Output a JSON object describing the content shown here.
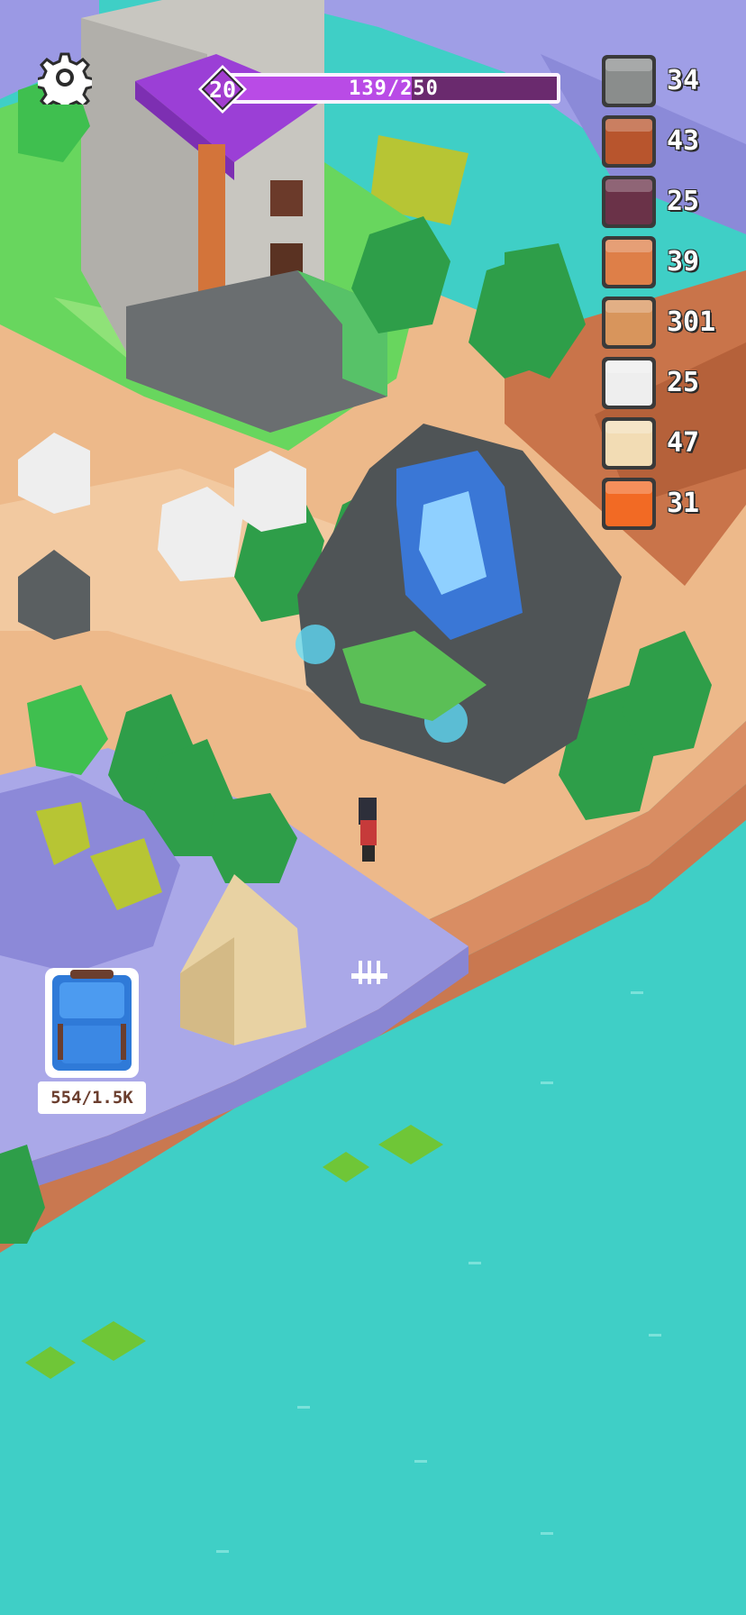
{
  "hud": {
    "settings_icon": "gear-icon",
    "level": "20",
    "xp_text": "139/250",
    "xp_progress": 0.556,
    "colors": {
      "xp_fill": "#b94be6",
      "xp_track": "#6a2a6e",
      "level_badge": "#a23dd0"
    }
  },
  "resources": [
    {
      "name": "stone-icon",
      "count": "34",
      "color": "#8a8d8c"
    },
    {
      "name": "wood-log-icon",
      "count": "43",
      "color": "#b8552d"
    },
    {
      "name": "dark-block-icon",
      "count": "25",
      "color": "#6a3248"
    },
    {
      "name": "copper-block-icon",
      "count": "39",
      "color": "#de7f48"
    },
    {
      "name": "sand-clay-icon",
      "count": "301",
      "color": "#d8955c"
    },
    {
      "name": "quartz-block-icon",
      "count": "25",
      "color": "#eeeeee"
    },
    {
      "name": "sandstone-icon",
      "count": "47",
      "color": "#f2dcb4"
    },
    {
      "name": "lava-block-icon",
      "count": "31",
      "color": "#f26a24"
    }
  ],
  "backpack": {
    "icon": "backpack-icon",
    "capacity": "554/1.5K"
  },
  "scene": {
    "water_color": "#3fcfc6",
    "sand_color": "#edb98a",
    "grass_color": "#68d65e",
    "stone_color": "#5e6466",
    "purple_ground": "#a9a7ea"
  }
}
